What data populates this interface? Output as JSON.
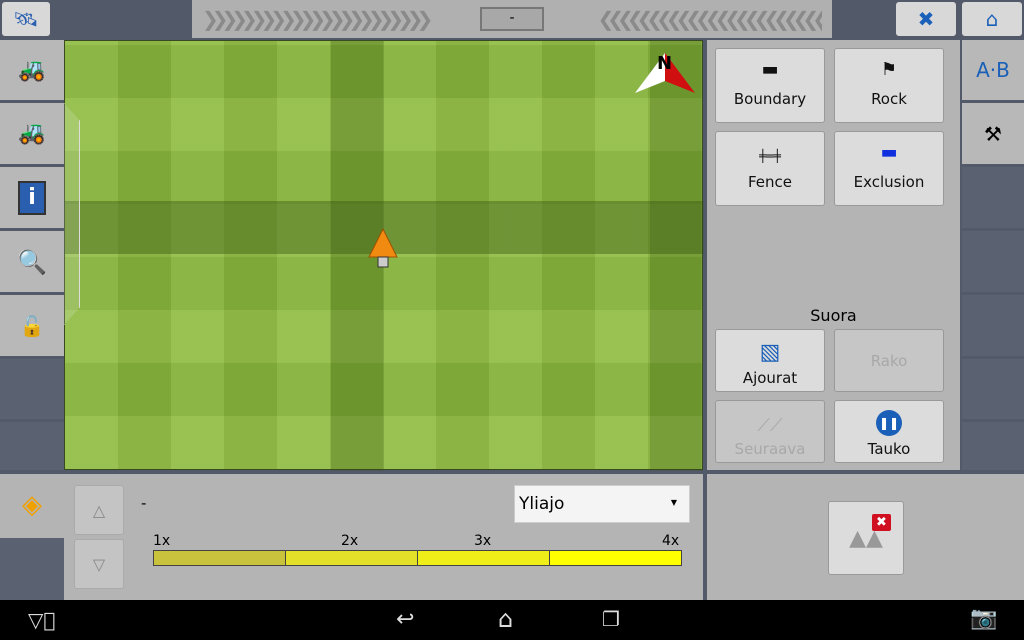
{
  "topbar": {
    "center_value": "-",
    "left_chevrons": "❯❯❯❯❯❯❯❯❯❯❯❯❯❯❯❯❯❯❯❯❯❯❯",
    "right_chevrons": "❮❮❮❮❮❮❮❮❮❮❮❮❮❮❮❮❮❮❮❮❮❮❮"
  },
  "sidebar": {
    "items": [
      {
        "icon": "gps-satellite-icon"
      },
      {
        "icon": "tractor-icon"
      },
      {
        "icon": "tractor-blue-icon"
      },
      {
        "icon": "info-icon"
      },
      {
        "icon": "zoom-icon"
      },
      {
        "icon": "lock-icon"
      }
    ]
  },
  "map": {
    "north_label": "N"
  },
  "panel": {
    "buttons": [
      {
        "label": "Boundary",
        "icon": "boundary-icon"
      },
      {
        "label": "Rock",
        "icon": "flag-icon"
      },
      {
        "label": "Fence",
        "icon": "fence-icon"
      },
      {
        "label": "Exclusion",
        "icon": "exclusion-icon"
      }
    ],
    "mode_label": "Suora",
    "actions": [
      {
        "label": "Ajourat",
        "enabled": true
      },
      {
        "label": "Rako",
        "enabled": false
      },
      {
        "label": "Seuraava",
        "enabled": false
      },
      {
        "label": "Tauko",
        "enabled": true
      }
    ]
  },
  "bottom": {
    "value": "-",
    "dropdown": "Yliajo",
    "scale_labels": [
      "1x",
      "2x",
      "3x",
      "4x"
    ],
    "scale_colors": [
      "#c8c23c",
      "#e4e02a",
      "#f0ee18",
      "#ffff00"
    ]
  }
}
